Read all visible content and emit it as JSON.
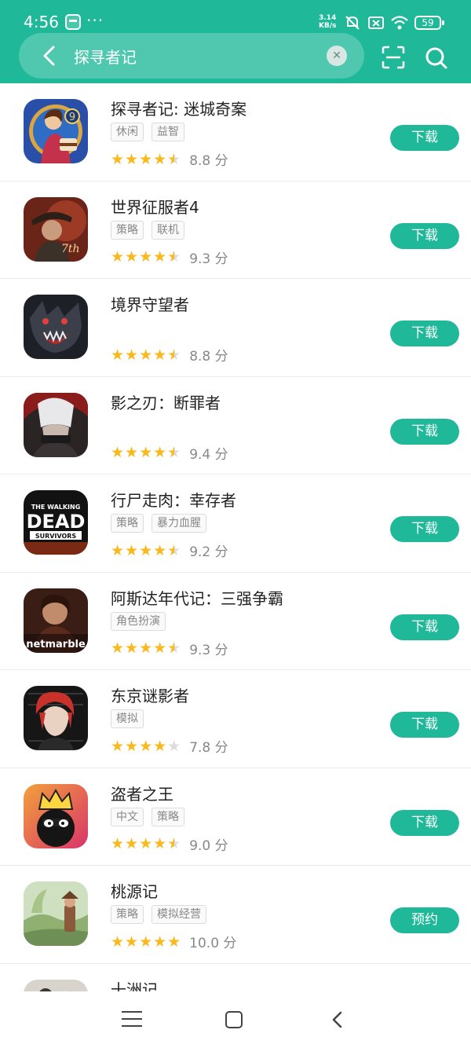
{
  "status_bar": {
    "time": "4:56",
    "more": "···",
    "net_speed_value": "3.14",
    "net_speed_unit": "KB/s",
    "battery": "59"
  },
  "search": {
    "query": "探寻者记",
    "back_icon": "back-arrow-icon",
    "clear_icon": "clear-icon",
    "scan_icon": "scan-icon",
    "search_icon": "search-icon"
  },
  "colors": {
    "brand": "#1fb99a",
    "star": "#f9b81b"
  },
  "results": [
    {
      "title": "探寻者记: 迷城奇案",
      "tags": [
        "休闲",
        "益智"
      ],
      "rating": 4.5,
      "score": "8.8 分",
      "action": "下载"
    },
    {
      "title": "世界征服者4",
      "tags": [
        "策略",
        "联机"
      ],
      "rating": 4.5,
      "score": "9.3 分",
      "action": "下载"
    },
    {
      "title": "境界守望者",
      "tags": [],
      "rating": 4.5,
      "score": "8.8 分",
      "action": "下载"
    },
    {
      "title": "影之刃：断罪者",
      "tags": [],
      "rating": 4.5,
      "score": "9.4 分",
      "action": "下载"
    },
    {
      "title": "行尸走肉：幸存者",
      "tags": [
        "策略",
        "暴力血腥"
      ],
      "rating": 4.5,
      "score": "9.2 分",
      "action": "下载"
    },
    {
      "title": "阿斯达年代记：三强争霸",
      "tags": [
        "角色扮演"
      ],
      "rating": 4.5,
      "score": "9.3 分",
      "action": "下载"
    },
    {
      "title": "东京谜影者",
      "tags": [
        "模拟"
      ],
      "rating": 4,
      "score": "7.8 分",
      "action": "下载"
    },
    {
      "title": "盗者之王",
      "tags": [
        "中文",
        "策略"
      ],
      "rating": 4.5,
      "score": "9.0 分",
      "action": "下载"
    },
    {
      "title": "桃源记",
      "tags": [
        "策略",
        "模拟经营"
      ],
      "rating": 5,
      "score": "10.0 分",
      "action": "预约"
    },
    {
      "title": "十洲记",
      "tags": [],
      "rating": 0,
      "score": "",
      "action": ""
    }
  ],
  "icon_art": {
    "walking_dead_line1": "THE WALKING",
    "walking_dead_line2": "DEAD",
    "walking_dead_line3": "SURVIVORS",
    "netmarble": "netmarble",
    "badge_9": "9",
    "anniv_7th": "7th"
  }
}
